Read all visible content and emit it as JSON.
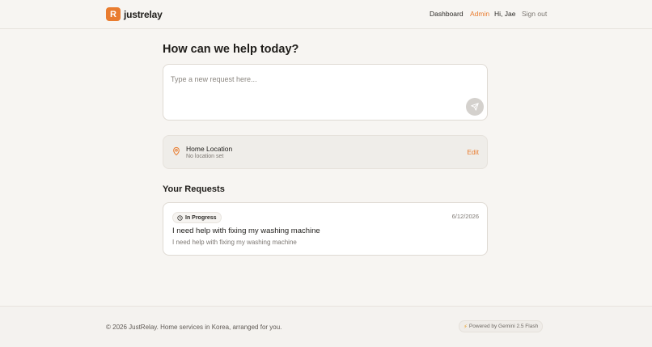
{
  "header": {
    "logo_letter": "R",
    "brand": "justrelay",
    "nav": {
      "dashboard": "Dashboard",
      "admin": "Admin",
      "user": "Hi, Jae",
      "signout": "Sign out"
    }
  },
  "main": {
    "title": "How can we help today?",
    "composer": {
      "placeholder": "Type a new request here...",
      "value": ""
    },
    "location": {
      "title": "Home Location",
      "subtitle": "No location set",
      "edit_label": "Edit"
    },
    "requests_title": "Your Requests",
    "requests": [
      {
        "status": "In Progress",
        "date": "6/12/2026",
        "title": "I need help with fixing my washing machine",
        "description": "I need help with fixing my washing machine"
      }
    ]
  },
  "footer": {
    "copyright": "© 2026 JustRelay. Home services in Korea, arranged for you.",
    "powered_by": "Powered by Gemini 2.5 Flash"
  },
  "icons": {
    "send": "send-icon",
    "pin": "map-pin-icon",
    "clock": "clock-icon",
    "bolt": "lightning-icon"
  },
  "colors": {
    "accent": "#e97c2f",
    "background": "#f7f5f2",
    "send_disabled": "#d4d1cd"
  }
}
